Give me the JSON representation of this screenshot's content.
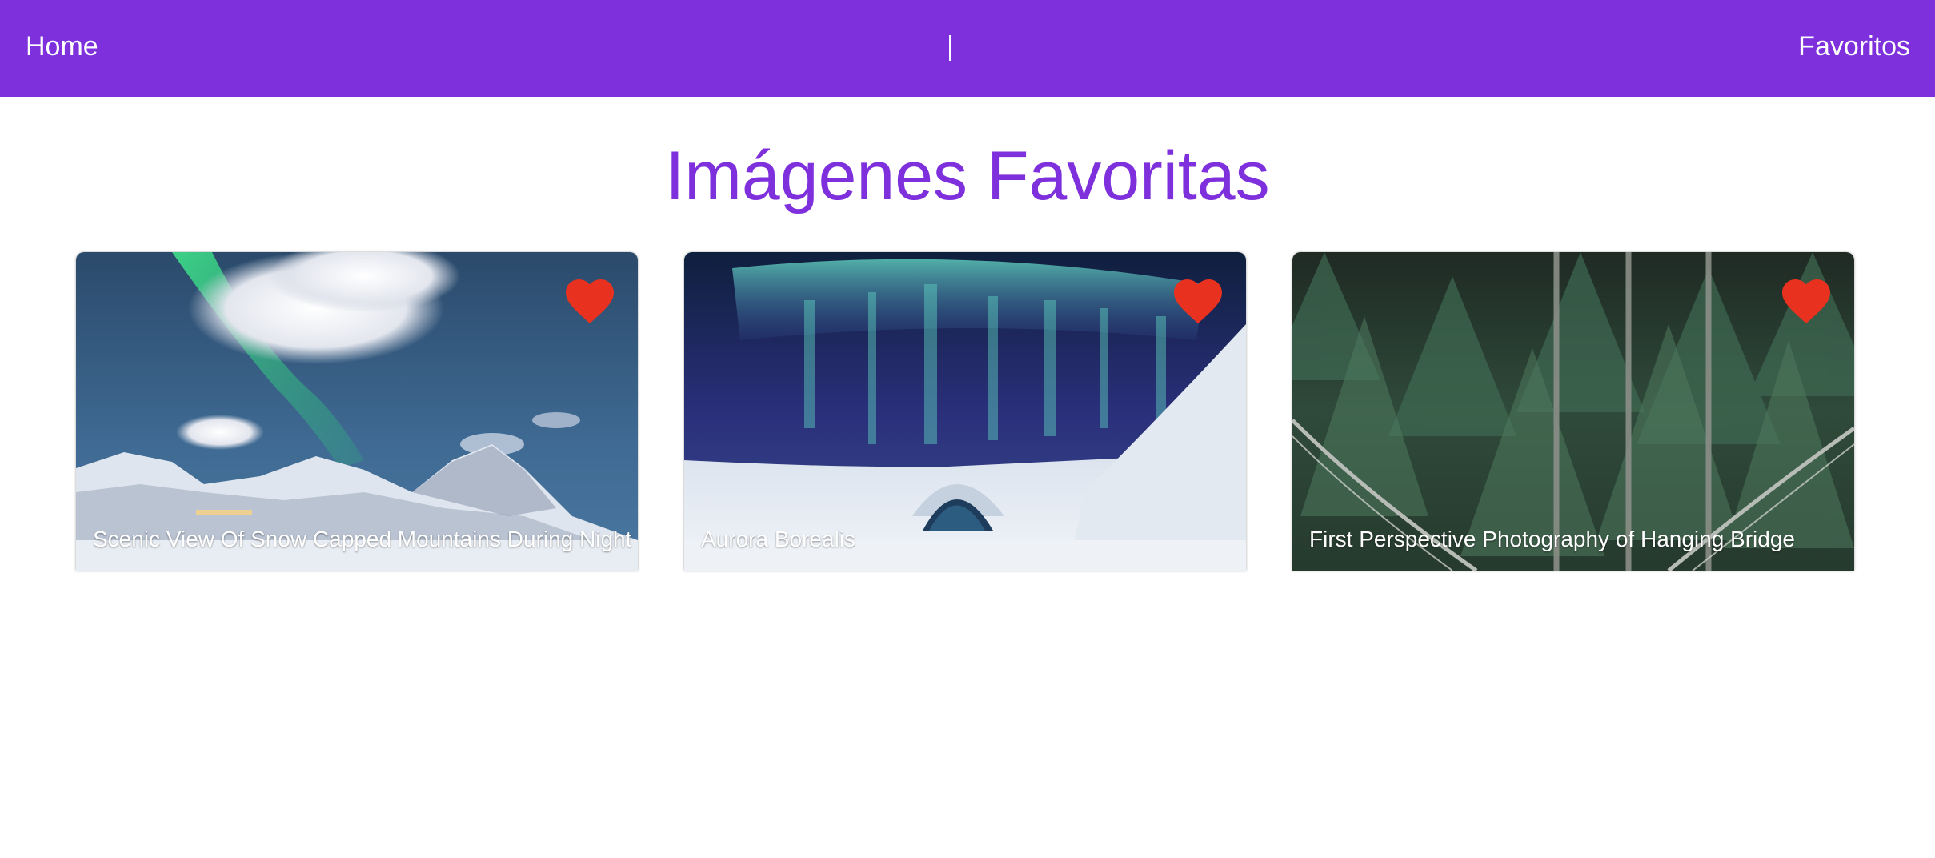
{
  "nav": {
    "home_label": "Home",
    "separator": "|",
    "favorites_label": "Favoritos"
  },
  "page": {
    "title": "Imágenes Favoritas"
  },
  "favorites": [
    {
      "caption": "Scenic View Of Snow Capped Mountains During Night",
      "favorited": true
    },
    {
      "caption": "Aurora Borealis",
      "favorited": true
    },
    {
      "caption": "First Perspective Photography of Hanging Bridge",
      "favorited": true
    }
  ],
  "colors": {
    "brand": "#7e30dc",
    "heart": "#e8321f",
    "caption_text": "#ffffff"
  },
  "icons": {
    "favorite": "heart-icon"
  }
}
